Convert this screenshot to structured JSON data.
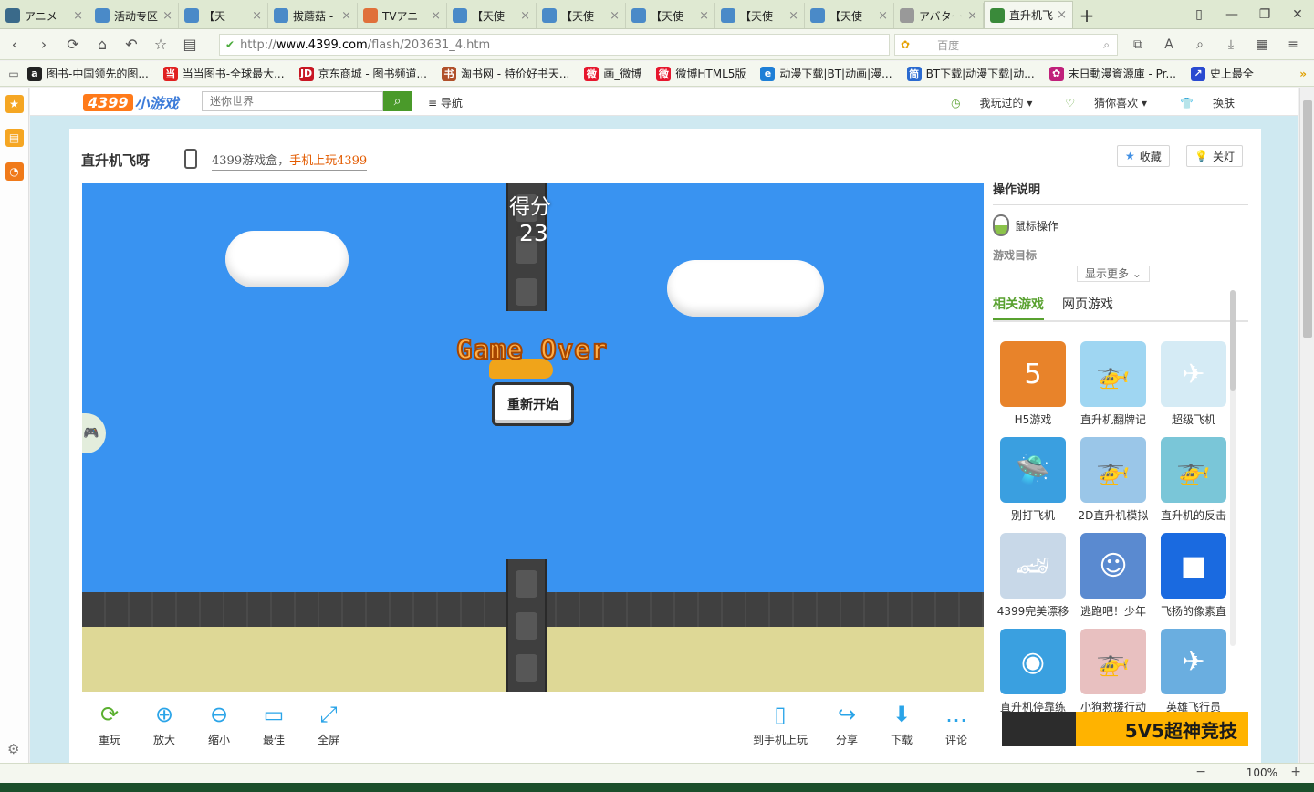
{
  "tabs": [
    {
      "label": "アニメ",
      "color": "#3a6a8a",
      "active": false
    },
    {
      "label": "活动专区",
      "color": "#4a8ac8",
      "active": false
    },
    {
      "label": "【天",
      "color": "#4a8ac8",
      "active": false
    },
    {
      "label": "拔蘑菇 -",
      "color": "#4a8ac8",
      "active": false
    },
    {
      "label": "TVアニ",
      "color": "#e0703a",
      "active": false
    },
    {
      "label": "【天使",
      "color": "#4a8ac8",
      "active": false
    },
    {
      "label": "【天使",
      "color": "#4a8ac8",
      "active": false
    },
    {
      "label": "【天使",
      "color": "#4a8ac8",
      "active": false
    },
    {
      "label": "【天使",
      "color": "#4a8ac8",
      "active": false
    },
    {
      "label": "【天使",
      "color": "#4a8ac8",
      "active": false
    },
    {
      "label": "アバター",
      "color": "#999999",
      "active": false
    },
    {
      "label": "直升机飞",
      "color": "#3a8a3a",
      "active": true
    }
  ],
  "address": {
    "scheme": "http://",
    "host": "www.4399.com",
    "path": "/flash/203631_4.htm",
    "engine_placeholder": "百度"
  },
  "bookmarks": [
    {
      "label": "图书-中国领先的图...",
      "icon_text": "a",
      "color": "#222222"
    },
    {
      "label": "当当图书-全球最大...",
      "icon_text": "当",
      "color": "#e02020"
    },
    {
      "label": "京东商城 - 图书频道...",
      "icon_text": "JD",
      "color": "#c81623"
    },
    {
      "label": "淘书网 - 特价好书天...",
      "icon_text": "书",
      "color": "#b0502a"
    },
    {
      "label": "画_微博",
      "icon_text": "微",
      "color": "#e6162d"
    },
    {
      "label": "微博HTML5版",
      "icon_text": "微",
      "color": "#e6162d"
    },
    {
      "label": "动漫下载|BT|动画|漫...",
      "icon_text": "e",
      "color": "#1e7fd6"
    },
    {
      "label": "BT下载|动漫下载|动...",
      "icon_text": "简",
      "color": "#2a6ad0"
    },
    {
      "label": "末日動漫資源庫 - Pr...",
      "icon_text": "✿",
      "color": "#c0207a"
    },
    {
      "label": "史上最全",
      "icon_text": "↗",
      "color": "#2a4ad0"
    }
  ],
  "site": {
    "logo_num": "4399",
    "logo_text": "小游戏",
    "search_placeholder": "迷你世界",
    "nav_label": "导航",
    "played_label": "我玩过的",
    "guess_label": "猜你喜欢",
    "skin_label": "换肤"
  },
  "game": {
    "title": "直升机飞呀",
    "promo_prefix": "4399游戏盒，",
    "promo_emphasis": "手机上玩4399",
    "favorite_label": "收藏",
    "lights_label": "关灯",
    "score_label": "得分",
    "score_value": "23",
    "gameover_text": "Game Over",
    "restart_label": "重新开始"
  },
  "toolbar": {
    "left": [
      {
        "label": "重玩",
        "icon": "reload-icon",
        "glyph": "⟳"
      },
      {
        "label": "放大",
        "icon": "zoom-in-icon",
        "glyph": "⊕"
      },
      {
        "label": "缩小",
        "icon": "zoom-out-icon",
        "glyph": "⊖"
      },
      {
        "label": "最佳",
        "icon": "best-fit-icon",
        "glyph": "▭"
      },
      {
        "label": "全屏",
        "icon": "fullscreen-icon",
        "glyph": "⤢"
      }
    ],
    "right": [
      {
        "label": "到手机上玩",
        "icon": "phone-icon",
        "glyph": "▯"
      },
      {
        "label": "分享",
        "icon": "share-icon",
        "glyph": "↪"
      },
      {
        "label": "下载",
        "icon": "download-icon",
        "glyph": "⬇"
      },
      {
        "label": "评论",
        "icon": "comment-icon",
        "glyph": "…"
      }
    ],
    "accent": "#2aa4e8"
  },
  "panel": {
    "instructions_title": "操作说明",
    "mouse_label": "鼠标操作",
    "goal_label": "游戏目标",
    "show_more": "显示更多",
    "tab_related": "相关游戏",
    "tab_web": "网页游戏",
    "games": [
      {
        "name": "H5游戏",
        "color": "#e8832a",
        "glyph": "5"
      },
      {
        "name": "直升机翻牌记",
        "color": "#9fd6f2",
        "glyph": "🚁"
      },
      {
        "name": "超级飞机",
        "color": "#d5ebf5",
        "glyph": "✈"
      },
      {
        "name": "别打飞机",
        "color": "#3a9fe0",
        "glyph": "🛸"
      },
      {
        "name": "2D直升机模拟",
        "color": "#9ac6e8",
        "glyph": "🚁"
      },
      {
        "name": "直升机的反击",
        "color": "#7ac6d8",
        "glyph": "🚁"
      },
      {
        "name": "4399完美漂移",
        "color": "#c8d8e8",
        "glyph": "🏎"
      },
      {
        "name": "逃跑吧！少年",
        "color": "#5a8ad0",
        "glyph": "☺"
      },
      {
        "name": "飞扬的像素直",
        "color": "#1a6ae0",
        "glyph": "■"
      },
      {
        "name": "直升机停靠练",
        "color": "#3aa0e0",
        "glyph": "◉"
      },
      {
        "name": "小狗救援行动",
        "color": "#e8c0c0",
        "glyph": "🚁"
      },
      {
        "name": "英雄飞行员",
        "color": "#6aaee0",
        "glyph": "✈"
      }
    ],
    "banner_text": "5V5超神竞技"
  },
  "status": {
    "zoom": "100%"
  }
}
